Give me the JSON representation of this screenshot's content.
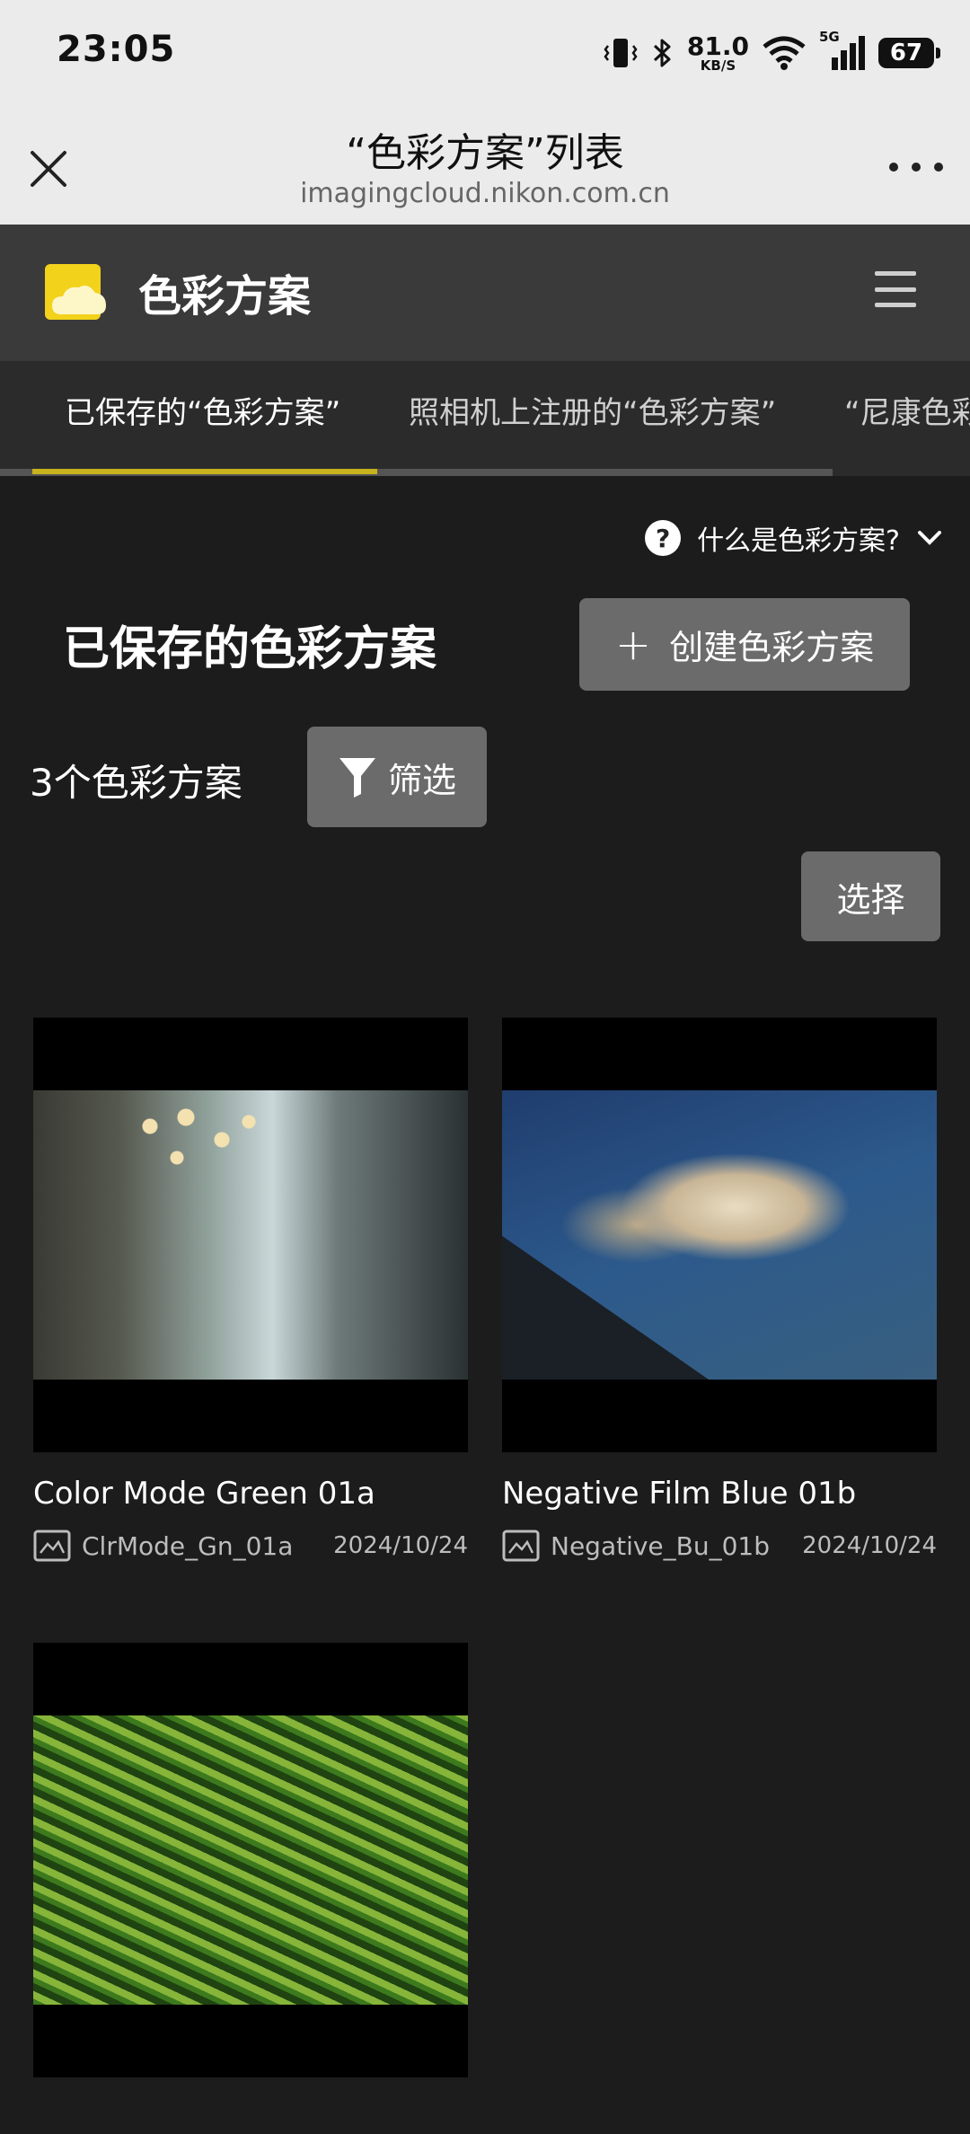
{
  "status_bar": {
    "time": "23:05",
    "net_speed_value": "81.0",
    "net_speed_unit": "KB/S",
    "network": "5G",
    "battery": "67"
  },
  "browser": {
    "title": "“色彩方案”列表",
    "url": "imagingcloud.nikon.com.cn"
  },
  "app_header": {
    "title": "色彩方案",
    "accent_color": "#c8b21d"
  },
  "tabs": [
    {
      "label": "已保存的“色彩方案”",
      "active": true
    },
    {
      "label": "照相机上注册的“色彩方案”",
      "active": false
    },
    {
      "label": "“尼康色彩",
      "active": false
    }
  ],
  "help": {
    "label": "什么是色彩方案?"
  },
  "section": {
    "title": "已保存的色彩方案",
    "create_label": "创建色彩方案",
    "count_label": "3个色彩方案",
    "filter_label": "筛选",
    "select_label": "选择"
  },
  "recipes": [
    {
      "name": "Color Mode Green 01a",
      "file": "ClrMode_Gn_01a",
      "date": "2024/10/24"
    },
    {
      "name": "Negative Film Blue 01b",
      "file": "Negative_Bu_01b",
      "date": "2024/10/24"
    },
    {
      "name": "",
      "file": "",
      "date": ""
    }
  ]
}
